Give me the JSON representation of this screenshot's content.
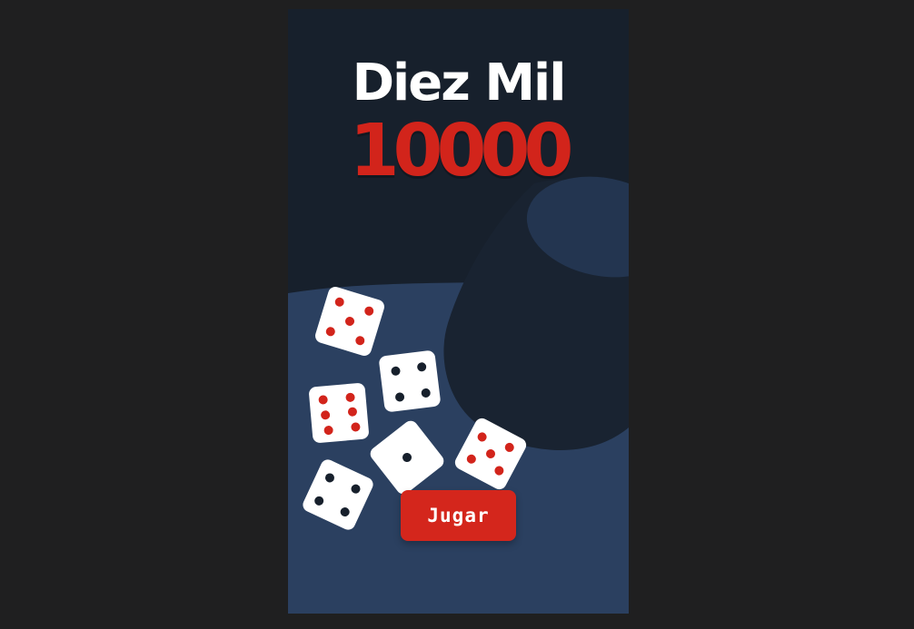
{
  "game": {
    "title": "Diez Mil",
    "subtitle": "10000",
    "play_button": "Jugar"
  },
  "colors": {
    "page_background": "#1f1f20",
    "phone_background": "#17202c",
    "table": "#2b4060",
    "cup_body": "#17202c",
    "cup_rim": "#233550",
    "die_face": "#ffffff",
    "red_pip": "#d2241b",
    "dark_pip": "#17202c",
    "button": "#d4261c"
  },
  "dice": [
    {
      "name": "red-five-top",
      "pip_color": "red",
      "value": 5
    },
    {
      "name": "dark-four-middle",
      "pip_color": "dark",
      "value": 4
    },
    {
      "name": "red-six-left",
      "pip_color": "red",
      "value": 6
    },
    {
      "name": "dark-one-center",
      "pip_color": "dark",
      "value": 1
    },
    {
      "name": "red-five-right",
      "pip_color": "red",
      "value": 5
    },
    {
      "name": "dark-four-bottom",
      "pip_color": "dark",
      "value": 4
    }
  ]
}
